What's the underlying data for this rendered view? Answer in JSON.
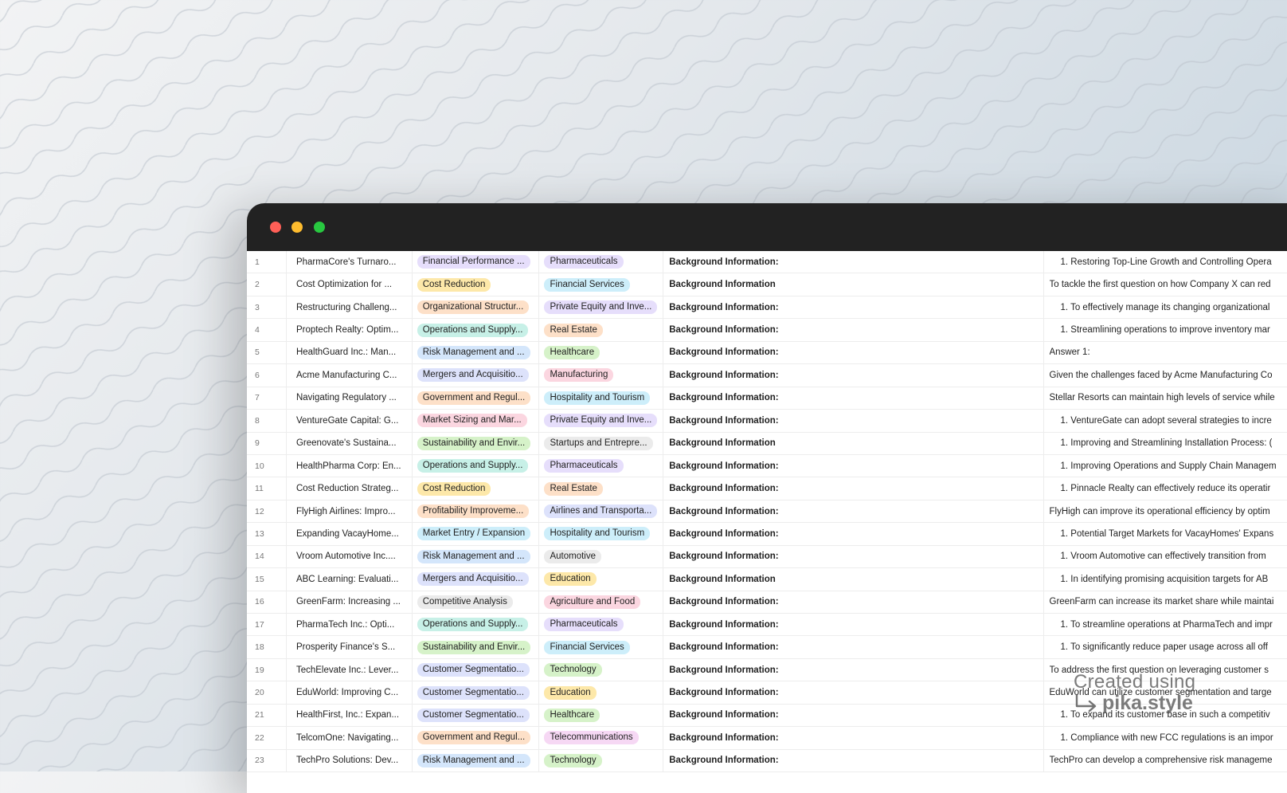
{
  "window": {
    "controls": [
      "close",
      "minimize",
      "maximize"
    ]
  },
  "tag_colors": {
    "purple": "#e6defb",
    "yellow": "#fde8a9",
    "orange": "#fde0c8",
    "teal": "#c7f0e7",
    "blue": "#d4e6fb",
    "indigo": "#dde2fb",
    "pink": "#fbd6e0",
    "green": "#d6f2c9",
    "gray": "#ebebeb",
    "cyan": "#cdeefa",
    "magenta": "#f6d8f4"
  },
  "rows": [
    {
      "num": "1",
      "title": "PharmaCore's Turnaro...",
      "category": {
        "label": "Financial Performance ...",
        "color": "purple"
      },
      "industry": {
        "label": "Pharmaceuticals",
        "color": "purple"
      },
      "background": "Background Information:",
      "answer": "1.  Restoring Top-Line Growth and Controlling Opera",
      "answer_list": true
    },
    {
      "num": "2",
      "title": "Cost Optimization for ...",
      "category": {
        "label": "Cost Reduction",
        "color": "yellow"
      },
      "industry": {
        "label": "Financial Services",
        "color": "cyan"
      },
      "background": "Background Information",
      "answer": "To tackle the first question on how Company X can red",
      "answer_list": false
    },
    {
      "num": "3",
      "title": "Restructuring Challeng...",
      "category": {
        "label": "Organizational Structur...",
        "color": "orange"
      },
      "industry": {
        "label": "Private Equity and Inve...",
        "color": "purple"
      },
      "background": "Background Information:",
      "answer": "1.  To effectively manage its changing organizational",
      "answer_list": true
    },
    {
      "num": "4",
      "title": "Proptech Realty: Optim...",
      "category": {
        "label": "Operations and Supply...",
        "color": "teal"
      },
      "industry": {
        "label": "Real Estate",
        "color": "orange"
      },
      "background": "Background Information:",
      "answer": "1.  Streamlining operations to improve inventory mar",
      "answer_list": true
    },
    {
      "num": "5",
      "title": "HealthGuard Inc.: Man...",
      "category": {
        "label": "Risk Management and ...",
        "color": "blue"
      },
      "industry": {
        "label": "Healthcare",
        "color": "green"
      },
      "background": "Background Information:",
      "answer": "Answer 1:",
      "answer_list": false
    },
    {
      "num": "6",
      "title": "Acme Manufacturing C...",
      "category": {
        "label": "Mergers and Acquisitio...",
        "color": "indigo"
      },
      "industry": {
        "label": "Manufacturing",
        "color": "pink"
      },
      "background": "Background Information:",
      "answer": "Given the challenges faced by Acme Manufacturing Co",
      "answer_list": false
    },
    {
      "num": "7",
      "title": "Navigating Regulatory ...",
      "category": {
        "label": "Government and Regul...",
        "color": "orange"
      },
      "industry": {
        "label": "Hospitality and Tourism",
        "color": "cyan"
      },
      "background": "Background Information:",
      "answer": "Stellar Resorts can maintain high levels of service while",
      "answer_list": false
    },
    {
      "num": "8",
      "title": "VentureGate Capital: G...",
      "category": {
        "label": "Market Sizing and Mar...",
        "color": "pink"
      },
      "industry": {
        "label": "Private Equity and Inve...",
        "color": "purple"
      },
      "background": "Background Information:",
      "answer": "1.  VentureGate can adopt several strategies to incre",
      "answer_list": true
    },
    {
      "num": "9",
      "title": "Greenovate's Sustaina...",
      "category": {
        "label": "Sustainability and Envir...",
        "color": "green"
      },
      "industry": {
        "label": "Startups and Entrepre...",
        "color": "gray"
      },
      "background": "Background Information",
      "answer": "1.  Improving and Streamlining Installation Process: (",
      "answer_list": true
    },
    {
      "num": "10",
      "title": "HealthPharma Corp: En...",
      "category": {
        "label": "Operations and Supply...",
        "color": "teal"
      },
      "industry": {
        "label": "Pharmaceuticals",
        "color": "purple"
      },
      "background": "Background Information:",
      "answer": "1.  Improving Operations and Supply Chain Managem",
      "answer_list": true
    },
    {
      "num": "11",
      "title": "Cost Reduction Strateg...",
      "category": {
        "label": "Cost Reduction",
        "color": "yellow"
      },
      "industry": {
        "label": "Real Estate",
        "color": "orange"
      },
      "background": "Background Information:",
      "answer": "1.  Pinnacle Realty can effectively reduce its operatir",
      "answer_list": true
    },
    {
      "num": "12",
      "title": "FlyHigh Airlines: Impro...",
      "category": {
        "label": "Profitability Improveme...",
        "color": "orange"
      },
      "industry": {
        "label": "Airlines and Transporta...",
        "color": "indigo"
      },
      "background": "Background Information:",
      "answer": "FlyHigh can improve its operational efficiency by optim",
      "answer_list": false
    },
    {
      "num": "13",
      "title": "Expanding VacayHome...",
      "category": {
        "label": "Market Entry / Expansion",
        "color": "cyan"
      },
      "industry": {
        "label": "Hospitality and Tourism",
        "color": "cyan"
      },
      "background": "Background Information:",
      "answer": "1.  Potential Target Markets for VacayHomes' Expans",
      "answer_list": true
    },
    {
      "num": "14",
      "title": "Vroom Automotive Inc....",
      "category": {
        "label": "Risk Management and ...",
        "color": "blue"
      },
      "industry": {
        "label": "Automotive",
        "color": "gray"
      },
      "background": "Background Information:",
      "answer": "1.  Vroom Automotive can effectively transition from",
      "answer_list": true
    },
    {
      "num": "15",
      "title": "ABC Learning: Evaluati...",
      "category": {
        "label": "Mergers and Acquisitio...",
        "color": "indigo"
      },
      "industry": {
        "label": "Education",
        "color": "yellow"
      },
      "background": "Background Information",
      "answer": "1.  In identifying promising acquisition targets for AB",
      "answer_list": true
    },
    {
      "num": "16",
      "title": "GreenFarm: Increasing ...",
      "category": {
        "label": "Competitive Analysis",
        "color": "gray"
      },
      "industry": {
        "label": "Agriculture and Food",
        "color": "pink"
      },
      "background": "Background Information:",
      "answer": "GreenFarm can increase its market share while maintai",
      "answer_list": false
    },
    {
      "num": "17",
      "title": "PharmaTech Inc.: Opti...",
      "category": {
        "label": "Operations and Supply...",
        "color": "teal"
      },
      "industry": {
        "label": "Pharmaceuticals",
        "color": "purple"
      },
      "background": "Background Information:",
      "answer": "1.  To streamline operations at PharmaTech and impr",
      "answer_list": true
    },
    {
      "num": "18",
      "title": "Prosperity Finance's S...",
      "category": {
        "label": "Sustainability and Envir...",
        "color": "green"
      },
      "industry": {
        "label": "Financial Services",
        "color": "cyan"
      },
      "background": "Background Information:",
      "answer": "1.  To significantly reduce paper usage across all off",
      "answer_list": true
    },
    {
      "num": "19",
      "title": "TechElevate Inc.: Lever...",
      "category": {
        "label": "Customer Segmentatio...",
        "color": "indigo"
      },
      "industry": {
        "label": "Technology",
        "color": "green"
      },
      "background": "Background Information:",
      "answer": "To address the first question on leveraging customer s",
      "answer_list": false
    },
    {
      "num": "20",
      "title": "EduWorld: Improving C...",
      "category": {
        "label": "Customer Segmentatio...",
        "color": "indigo"
      },
      "industry": {
        "label": "Education",
        "color": "yellow"
      },
      "background": "Background Information:",
      "answer": "EduWorld can utilize customer segmentation and targe",
      "answer_list": false
    },
    {
      "num": "21",
      "title": "HealthFirst, Inc.: Expan...",
      "category": {
        "label": "Customer Segmentatio...",
        "color": "indigo"
      },
      "industry": {
        "label": "Healthcare",
        "color": "green"
      },
      "background": "Background Information:",
      "answer": "1.  To expand its customer base in such a competitiv",
      "answer_list": true
    },
    {
      "num": "22",
      "title": "TelcomOne: Navigating...",
      "category": {
        "label": "Government and Regul...",
        "color": "orange"
      },
      "industry": {
        "label": "Telecommunications",
        "color": "magenta"
      },
      "background": "Background Information:",
      "answer": "1.  Compliance with new FCC regulations is an impor",
      "answer_list": true
    },
    {
      "num": "23",
      "title": "TechPro Solutions: Dev...",
      "category": {
        "label": "Risk Management and ...",
        "color": "blue"
      },
      "industry": {
        "label": "Technology",
        "color": "green"
      },
      "background": "Background Information:",
      "answer": "TechPro can develop a comprehensive risk manageme",
      "answer_list": false
    }
  ],
  "watermark": {
    "line1": "Created using",
    "line2": "pika.style"
  }
}
